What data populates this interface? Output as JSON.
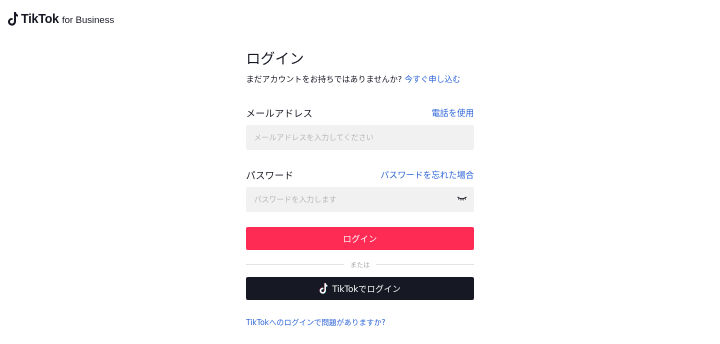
{
  "header": {
    "brand": "TikTok",
    "brand_suffix": "for Business",
    "logo_icon": "tiktok-note-icon"
  },
  "login": {
    "title": "ログイン",
    "signup_prompt": "まだアカウントをお持ちではありませんか?",
    "signup_link": "今すぐ申し込む",
    "email": {
      "label": "メールアドレス",
      "alt_link": "電話を使用",
      "placeholder": "メールアドレスを入力してください",
      "value": ""
    },
    "password": {
      "label": "パスワード",
      "forgot_link": "パスワードを忘れた場合",
      "placeholder": "パスワードを入力します",
      "value": "",
      "toggle_icon": "eye-closed-icon"
    },
    "submit_label": "ログイン",
    "divider_text": "または",
    "tiktok_login_label": "TikTokでログイン",
    "help_link": "TikTokへのログインで問題がありますか?"
  },
  "colors": {
    "primary": "#fe2c55",
    "dark": "#161823",
    "link": "#2a62d8",
    "input_bg": "#f1f1f2"
  }
}
